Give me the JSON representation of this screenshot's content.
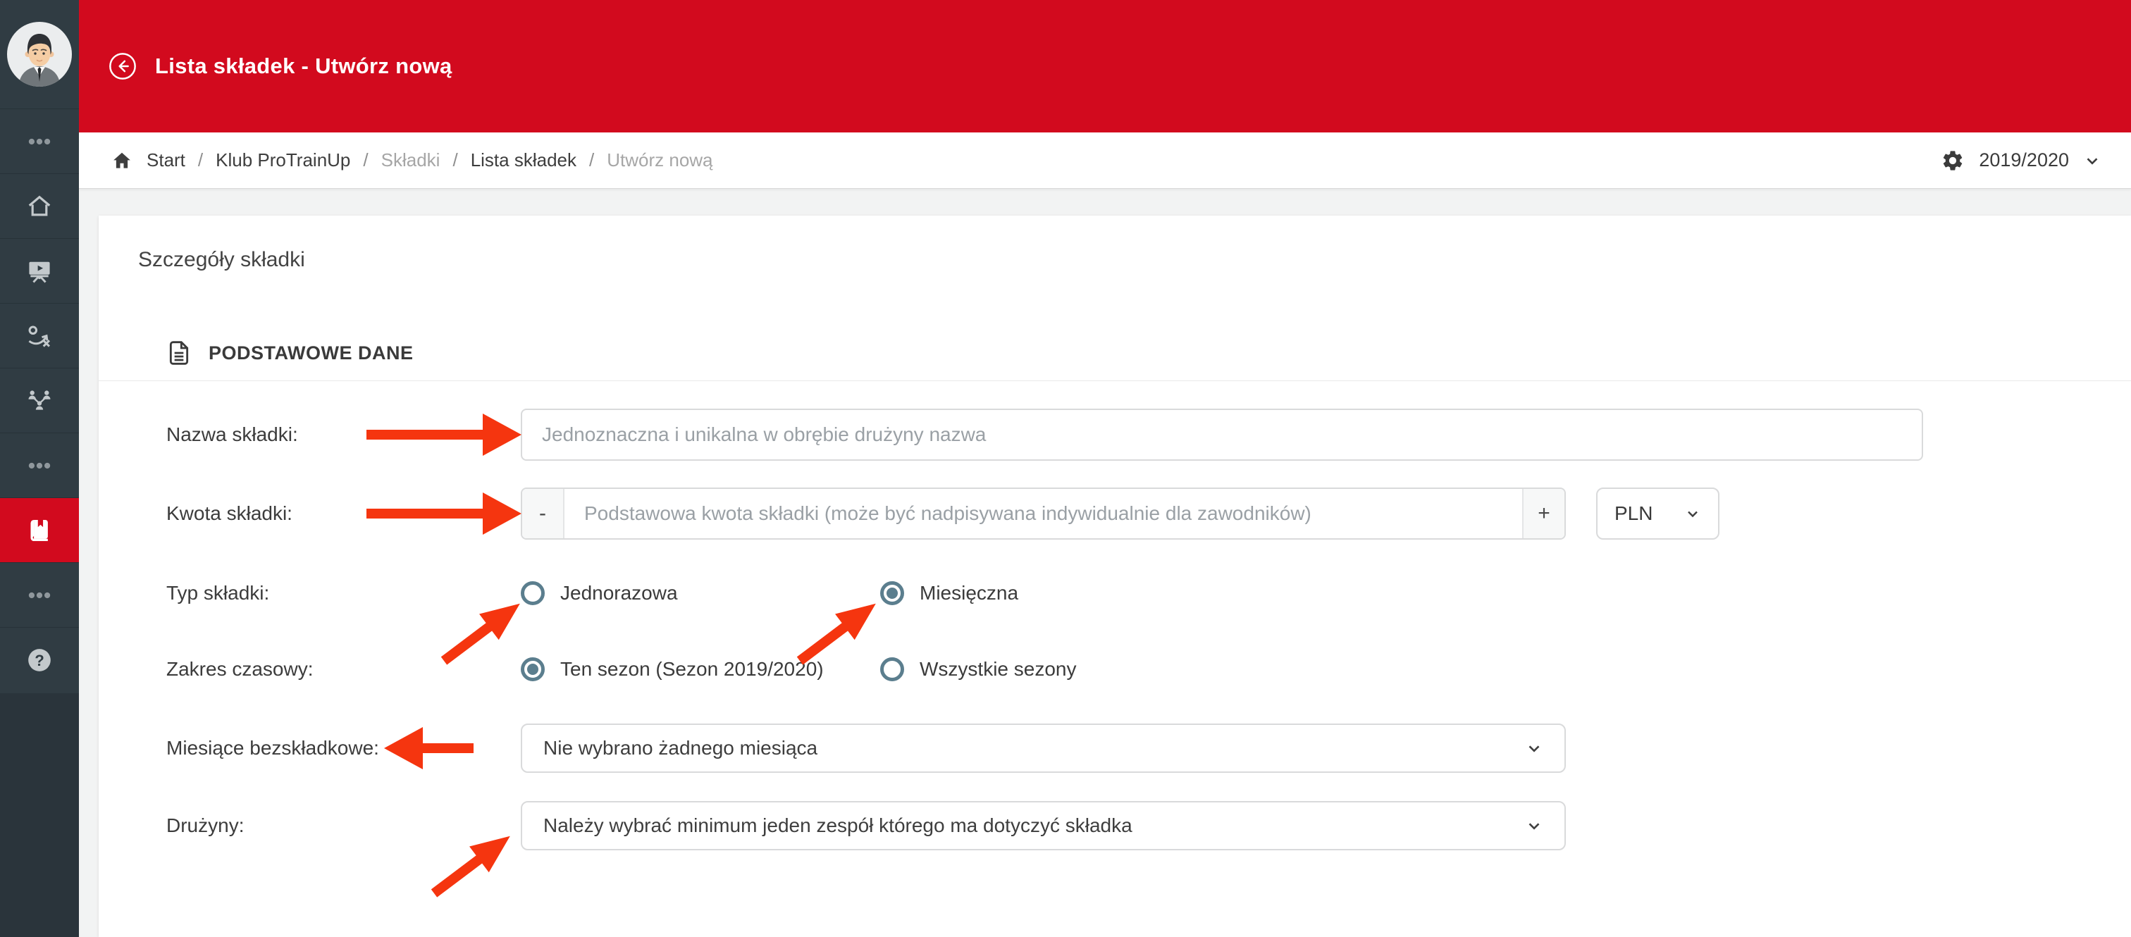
{
  "header": {
    "title": "Lista składek - Utwórz nową"
  },
  "breadcrumb": {
    "separator": "/",
    "items": [
      {
        "label": "Start",
        "muted": false
      },
      {
        "label": "Klub ProTrainUp",
        "muted": false
      },
      {
        "label": "Składki",
        "muted": true
      },
      {
        "label": "Lista składek",
        "muted": false
      },
      {
        "label": "Utwórz nową",
        "muted": true
      }
    ]
  },
  "season": {
    "value": "2019/2020"
  },
  "card": {
    "title": "Szczegóły składki",
    "section": "PODSTAWOWE DANE"
  },
  "form": {
    "name": {
      "label": "Nazwa składki:",
      "placeholder": "Jednoznaczna i unikalna w obrębie drużyny nazwa",
      "value": ""
    },
    "amount": {
      "label": "Kwota składki:",
      "placeholder": "Podstawowa kwota składki (może być nadpisywana indywidualnie dla zawodników)",
      "value": "",
      "minus": "-",
      "plus": "+",
      "currency": "PLN"
    },
    "type": {
      "label": "Typ składki:",
      "options": [
        {
          "label": "Jednorazowa",
          "checked": false
        },
        {
          "label": "Miesięczna",
          "checked": true
        }
      ]
    },
    "range": {
      "label": "Zakres czasowy:",
      "options": [
        {
          "label": "Ten sezon (Sezon 2019/2020)",
          "checked": true
        },
        {
          "label": "Wszystkie sezony",
          "checked": false
        }
      ]
    },
    "months": {
      "label": "Miesiące bezskładkowe:",
      "value": "Nie wybrano żadnego miesiąca"
    },
    "teams": {
      "label": "Drużyny:",
      "value": "Należy wybrać minimum jeden zespół którego ma dotyczyć składka"
    }
  },
  "sidebar": {
    "help_glyph": "?",
    "items": [
      {
        "icon": "menu-dots-icon",
        "active": false
      },
      {
        "icon": "home-icon",
        "active": false
      },
      {
        "icon": "training-board-icon",
        "active": false
      },
      {
        "icon": "tactics-icon",
        "active": false
      },
      {
        "icon": "team-structure-icon",
        "active": false
      },
      {
        "icon": "menu-dots-icon",
        "active": false
      },
      {
        "icon": "fees-book-icon",
        "active": true
      },
      {
        "icon": "menu-dots-icon",
        "active": false
      },
      {
        "icon": "help-icon",
        "active": false
      }
    ]
  },
  "colors": {
    "accent_red": "#d20a1e",
    "radio": "#5b7e8e",
    "arrow": "#f5350f",
    "sidebar_bg": "#303c43"
  }
}
